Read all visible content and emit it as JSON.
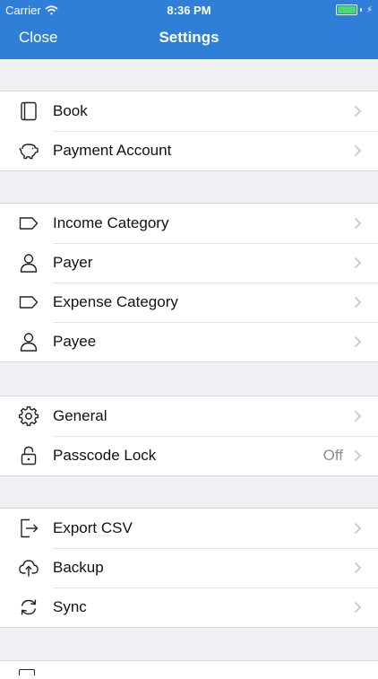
{
  "status_bar": {
    "carrier": "Carrier",
    "time": "8:36 PM",
    "battery_level": 1.0
  },
  "nav": {
    "close_label": "Close",
    "title": "Settings"
  },
  "sections": [
    {
      "items": [
        {
          "label": "Book",
          "icon": "book-icon"
        },
        {
          "label": "Payment Account",
          "icon": "piggy-bank-icon"
        }
      ]
    },
    {
      "items": [
        {
          "label": "Income Category",
          "icon": "tag-icon"
        },
        {
          "label": "Payer",
          "icon": "person-icon"
        },
        {
          "label": "Expense Category",
          "icon": "tag-icon"
        },
        {
          "label": "Payee",
          "icon": "person-icon"
        }
      ]
    },
    {
      "items": [
        {
          "label": "General",
          "icon": "gear-icon"
        },
        {
          "label": "Passcode Lock",
          "icon": "lock-icon",
          "value": "Off"
        }
      ]
    },
    {
      "items": [
        {
          "label": "Export CSV",
          "icon": "export-icon"
        },
        {
          "label": "Backup",
          "icon": "cloud-upload-icon"
        },
        {
          "label": "Sync",
          "icon": "sync-icon"
        }
      ]
    }
  ],
  "colors": {
    "nav_bar": "#2f7fd9",
    "background": "#efeff4",
    "icon_stroke": "#222222",
    "chevron": "#c7c7cc"
  }
}
